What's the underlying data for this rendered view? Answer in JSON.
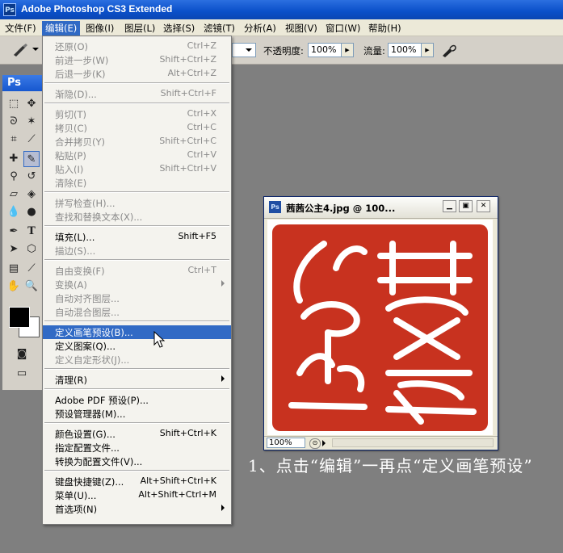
{
  "app": {
    "icon": "Ps",
    "title": "Adobe Photoshop CS3 Extended"
  },
  "menubar": [
    "文件(F)",
    "编辑(E)",
    "图像(I)",
    "图层(L)",
    "选择(S)",
    "滤镜(T)",
    "分析(A)",
    "视图(V)",
    "窗口(W)",
    "帮助(H)"
  ],
  "options": {
    "opacity_label": "不透明度:",
    "opacity_value": "100%",
    "flow_label": "流量:",
    "flow_value": "100%"
  },
  "toolbox": {
    "logo": "Ps"
  },
  "edit_menu": [
    {
      "label": "还原(O)",
      "shortcut": "Ctrl+Z",
      "enabled": false
    },
    {
      "label": "前进一步(W)",
      "shortcut": "Shift+Ctrl+Z",
      "enabled": false
    },
    {
      "label": "后退一步(K)",
      "shortcut": "Alt+Ctrl+Z",
      "enabled": false
    },
    {
      "separator": true
    },
    {
      "label": "渐隐(D)...",
      "shortcut": "Shift+Ctrl+F",
      "enabled": false
    },
    {
      "separator": true
    },
    {
      "label": "剪切(T)",
      "shortcut": "Ctrl+X",
      "enabled": false
    },
    {
      "label": "拷贝(C)",
      "shortcut": "Ctrl+C",
      "enabled": false
    },
    {
      "label": "合并拷贝(Y)",
      "shortcut": "Shift+Ctrl+C",
      "enabled": false
    },
    {
      "label": "粘贴(P)",
      "shortcut": "Ctrl+V",
      "enabled": false
    },
    {
      "label": "贴入(I)",
      "shortcut": "Shift+Ctrl+V",
      "enabled": false
    },
    {
      "label": "清除(E)",
      "shortcut": "",
      "enabled": false
    },
    {
      "separator": true
    },
    {
      "label": "拼写检查(H)...",
      "shortcut": "",
      "enabled": false
    },
    {
      "label": "查找和替换文本(X)...",
      "shortcut": "",
      "enabled": false
    },
    {
      "separator": true
    },
    {
      "label": "填充(L)...",
      "shortcut": "Shift+F5",
      "enabled": true
    },
    {
      "label": "描边(S)...",
      "shortcut": "",
      "enabled": false
    },
    {
      "separator": true
    },
    {
      "label": "自由变换(F)",
      "shortcut": "Ctrl+T",
      "enabled": false
    },
    {
      "label": "变换(A)",
      "shortcut": "",
      "enabled": false,
      "submenu": true
    },
    {
      "label": "自动对齐图层...",
      "shortcut": "",
      "enabled": false
    },
    {
      "label": "自动混合图层...",
      "shortcut": "",
      "enabled": false
    },
    {
      "separator": true
    },
    {
      "label": "定义画笔预设(B)...",
      "shortcut": "",
      "enabled": true,
      "highlighted": true
    },
    {
      "label": "定义图案(Q)...",
      "shortcut": "",
      "enabled": true
    },
    {
      "label": "定义自定形状(J)...",
      "shortcut": "",
      "enabled": false
    },
    {
      "separator": true
    },
    {
      "label": "清理(R)",
      "shortcut": "",
      "enabled": true,
      "submenu": true
    },
    {
      "separator": true
    },
    {
      "label": "Adobe PDF 预设(P)...",
      "shortcut": "",
      "enabled": true
    },
    {
      "label": "预设管理器(M)...",
      "shortcut": "",
      "enabled": true
    },
    {
      "separator": true
    },
    {
      "label": "颜色设置(G)...",
      "shortcut": "Shift+Ctrl+K",
      "enabled": true
    },
    {
      "label": "指定配置文件...",
      "shortcut": "",
      "enabled": true
    },
    {
      "label": "转换为配置文件(V)...",
      "shortcut": "",
      "enabled": true
    },
    {
      "separator": true
    },
    {
      "label": "键盘快捷键(Z)...",
      "shortcut": "Alt+Shift+Ctrl+K",
      "enabled": true
    },
    {
      "label": "菜单(U)...",
      "shortcut": "Alt+Shift+Ctrl+M",
      "enabled": true
    },
    {
      "label": "首选项(N)",
      "shortcut": "",
      "enabled": true,
      "submenu": true
    }
  ],
  "document": {
    "icon": "Ps",
    "title": "茜茜公主4.jpg @ 100...",
    "zoom": "100%"
  },
  "caption": "1、点击“编辑”一再点“定义画笔预设”",
  "colors": {
    "title_blue": "#0a4fc9",
    "menu_highlight": "#316ac5",
    "seal_red": "#c8321f",
    "workspace_gray": "#7f7f7f"
  }
}
